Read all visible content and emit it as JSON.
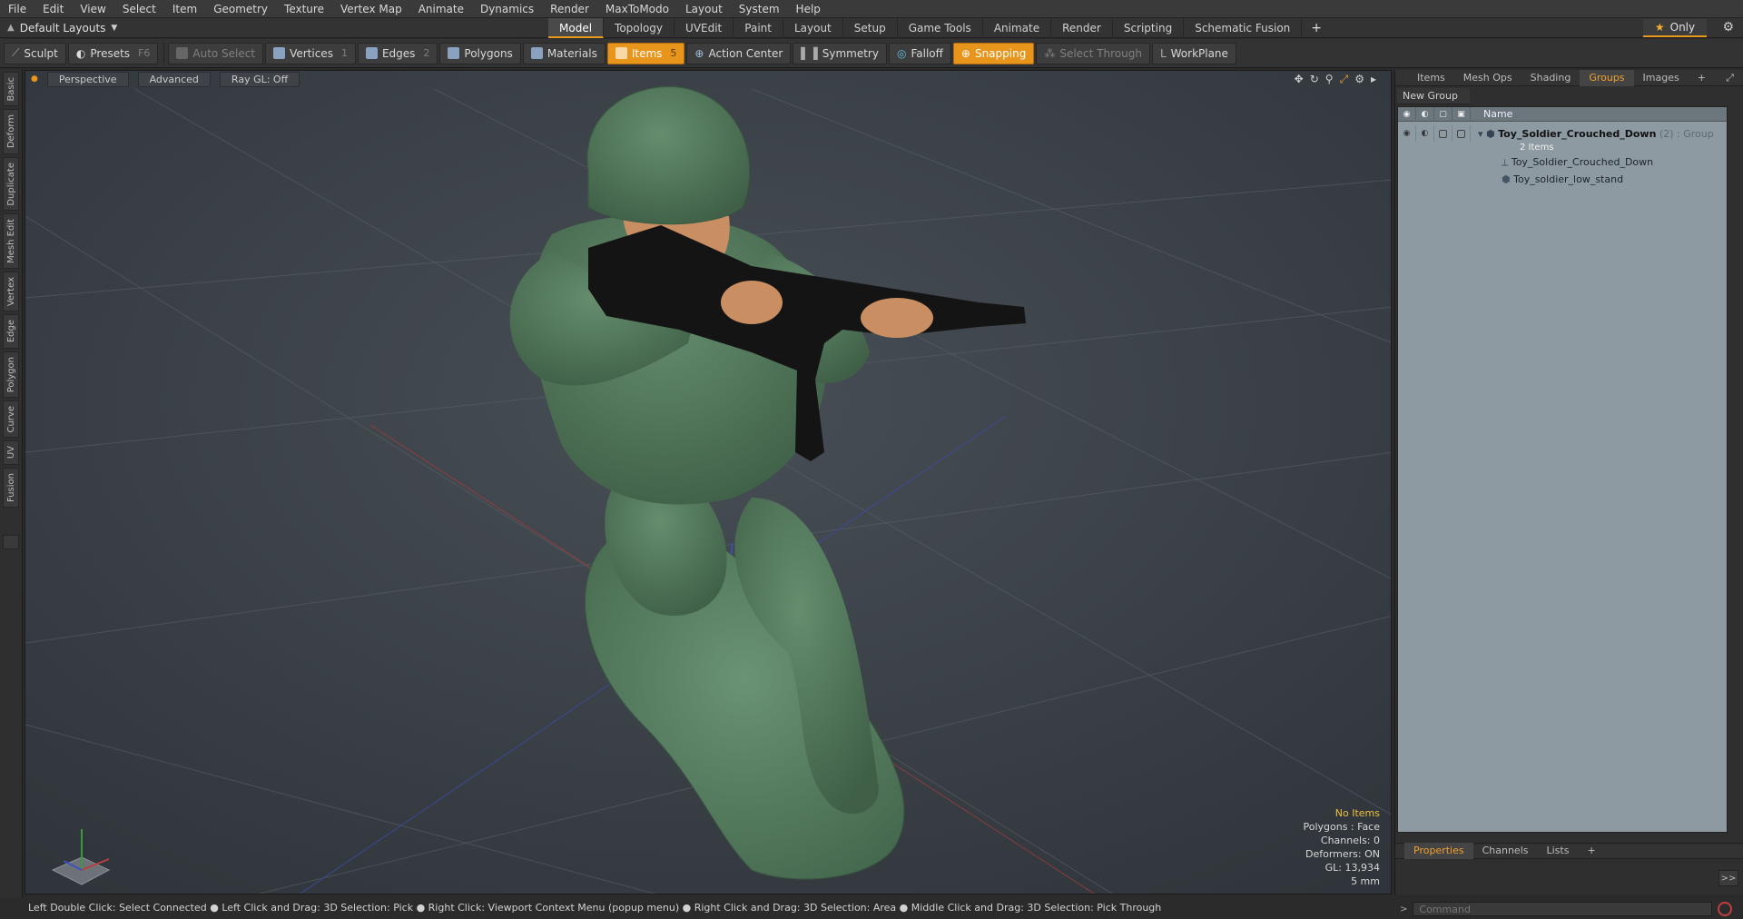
{
  "menu": [
    "File",
    "Edit",
    "View",
    "Select",
    "Item",
    "Geometry",
    "Texture",
    "Vertex Map",
    "Animate",
    "Dynamics",
    "Render",
    "MaxToModo",
    "Layout",
    "System",
    "Help"
  ],
  "layout_selector": "Default Layouts",
  "tabs": [
    {
      "label": "Model",
      "active": true
    },
    {
      "label": "Topology"
    },
    {
      "label": "UVEdit"
    },
    {
      "label": "Paint"
    },
    {
      "label": "Layout"
    },
    {
      "label": "Setup"
    },
    {
      "label": "Game Tools"
    },
    {
      "label": "Animate"
    },
    {
      "label": "Render"
    },
    {
      "label": "Scripting"
    },
    {
      "label": "Schematic Fusion"
    }
  ],
  "only_label": "Only",
  "toolbar": {
    "sculpt": "Sculpt",
    "presets": "Presets",
    "presets_key": "F6",
    "auto_select": "Auto Select",
    "vertices": "Vertices",
    "vertices_key": "1",
    "edges": "Edges",
    "edges_key": "2",
    "polygons": "Polygons",
    "materials": "Materials",
    "items": "Items",
    "items_key": "5",
    "action_center": "Action Center",
    "symmetry": "Symmetry",
    "falloff": "Falloff",
    "snapping": "Snapping",
    "select_through": "Select Through",
    "workplane": "WorkPlane"
  },
  "left_tabs": [
    "Basic",
    "Deform",
    "Duplicate",
    "Mesh Edit",
    "Vertex",
    "Edge",
    "Polygon",
    "Curve",
    "UV",
    "Fusion"
  ],
  "viewport": {
    "view": "Perspective",
    "shading": "Advanced",
    "raygl": "Ray GL: Off",
    "info": {
      "selection": "No Items",
      "polygons": "Polygons : Face",
      "channels": "Channels: 0",
      "deformers": "Deformers: ON",
      "gl": "GL: 13,934",
      "scale": "5 mm"
    }
  },
  "right_panel": {
    "tabs": [
      {
        "label": "Items"
      },
      {
        "label": "Mesh Ops"
      },
      {
        "label": "Shading"
      },
      {
        "label": "Groups",
        "active": true
      },
      {
        "label": "Images"
      }
    ],
    "new_group": "New Group",
    "name_header": "Name",
    "group": {
      "name": "Toy_Soldier_Crouched_Down",
      "count": "(2)",
      "type": ": Group",
      "items_count": "2 Items",
      "children": [
        "Toy_Soldier_Crouched_Down",
        "Toy_soldier_low_stand"
      ]
    },
    "bottom_tabs": [
      {
        "label": "Properties",
        "active": true
      },
      {
        "label": "Channels"
      },
      {
        "label": "Lists"
      }
    ],
    "expand_label": ">>"
  },
  "status_bar": "Left Double Click: Select Connected ● Left Click and Drag: 3D Selection: Pick ● Right Click: Viewport Context Menu (popup menu) ● Right Click and Drag: 3D Selection: Area ● Middle Click and Drag: 3D Selection: Pick Through",
  "command_placeholder": "Command",
  "colors": {
    "accent": "#e8951c",
    "viewport_bg": "#3a4046",
    "soldier": "#4f7558",
    "tree_bg": "#8e9aa2"
  }
}
